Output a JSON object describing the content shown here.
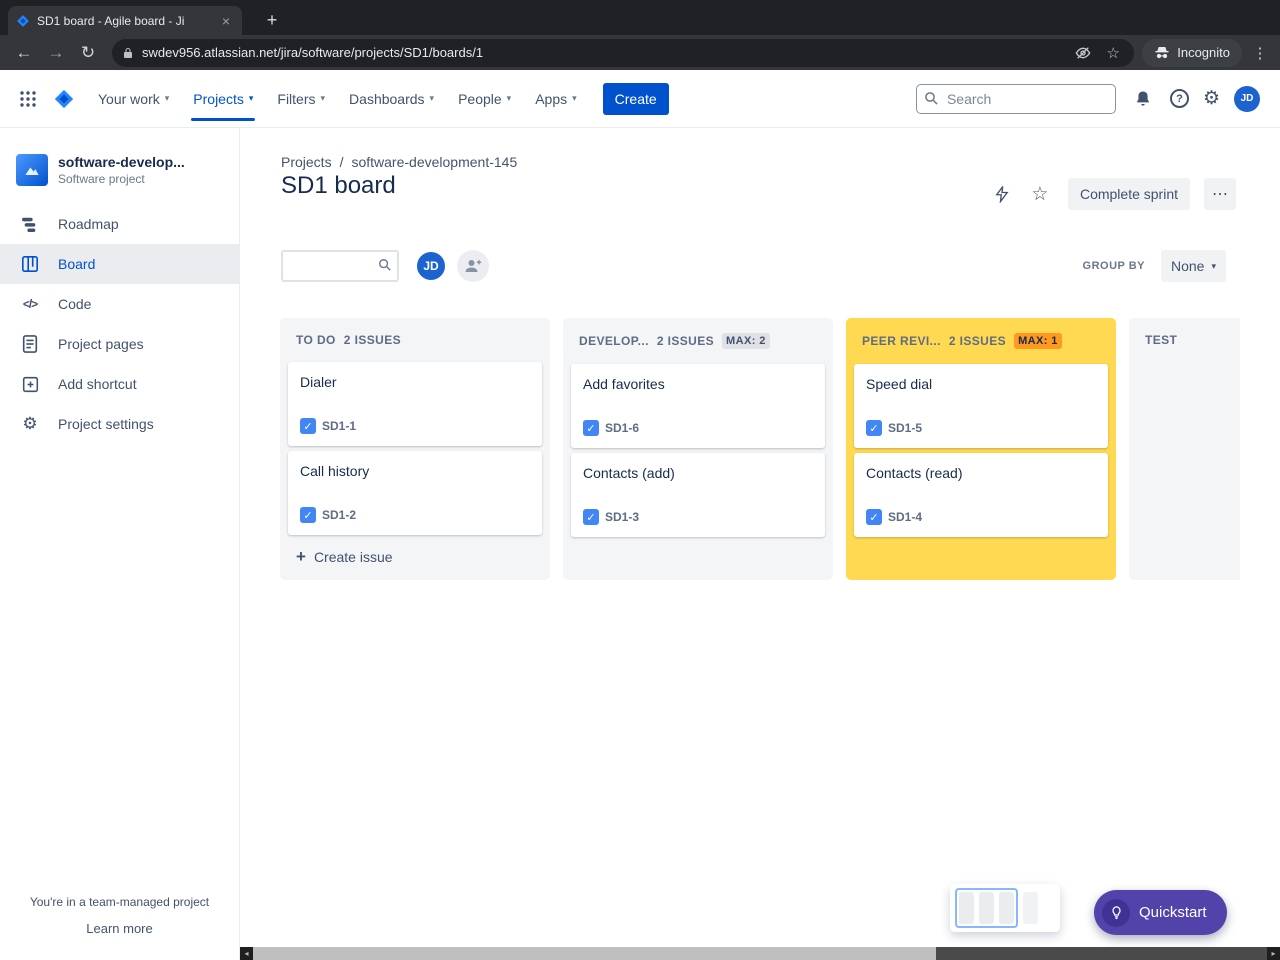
{
  "browser": {
    "tab_title": "SD1 board - Agile board - Ji",
    "url": "swdev956.atlassian.net/jira/software/projects/SD1/boards/1",
    "incognito_label": "Incognito"
  },
  "topnav": {
    "items": [
      "Your work",
      "Projects",
      "Filters",
      "Dashboards",
      "People",
      "Apps"
    ],
    "create_label": "Create",
    "search_placeholder": "Search",
    "avatar_initials": "JD"
  },
  "sidebar": {
    "project_name": "software-develop...",
    "project_type": "Software project",
    "items": [
      "Roadmap",
      "Board",
      "Code",
      "Project pages",
      "Add shortcut",
      "Project settings"
    ],
    "footer_text": "You're in a team-managed project",
    "footer_link_label": "Learn more"
  },
  "header": {
    "breadcrumb_1": "Projects",
    "breadcrumb_2": "software-development-145",
    "title": "SD1 board",
    "complete_sprint_label": "Complete sprint"
  },
  "toolbar": {
    "board_avatar_initials": "JD",
    "group_by_label": "GROUP BY",
    "group_by_value": "None"
  },
  "board": {
    "create_issue_label": "Create issue",
    "columns": [
      {
        "name": "TO DO",
        "count": "2 ISSUES",
        "max": "",
        "cards": [
          {
            "title": "Dialer",
            "key": "SD1-1"
          },
          {
            "title": "Call history",
            "key": "SD1-2"
          }
        ]
      },
      {
        "name": "DEVELOP...",
        "count": "2 ISSUES",
        "max": "MAX: 2",
        "cards": [
          {
            "title": "Add favorites",
            "key": "SD1-6"
          },
          {
            "title": "Contacts (add)",
            "key": "SD1-3"
          }
        ]
      },
      {
        "name": "PEER REVI...",
        "count": "2 ISSUES",
        "max": "MAX: 1",
        "cards": [
          {
            "title": "Speed dial",
            "key": "SD1-5"
          },
          {
            "title": "Contacts (read)",
            "key": "SD1-4"
          }
        ]
      },
      {
        "name": "TEST",
        "count": "",
        "max": "",
        "cards": []
      }
    ]
  },
  "quickstart": {
    "label": "Quickstart"
  },
  "icons": {
    "chevron_down": "▾",
    "gear": "⚙",
    "star": "☆",
    "kebab_vertical": "⋮",
    "more_horizontal": "⋯",
    "plus": "+",
    "close": "×",
    "check": "✓",
    "back_arrow": "←",
    "forward_arrow": "→",
    "reload": "↻",
    "question": "?",
    "slash": "/",
    "scroll_left": "◂",
    "scroll_right": "▸",
    "code": "</>"
  },
  "colors": {
    "brand_blue": "#0052CC",
    "warning_column_yellow": "#FFD951",
    "max_badge_orange": "#FF991F",
    "task_icon_blue": "#4285F4",
    "quickstart_purple": "#5243AA"
  }
}
